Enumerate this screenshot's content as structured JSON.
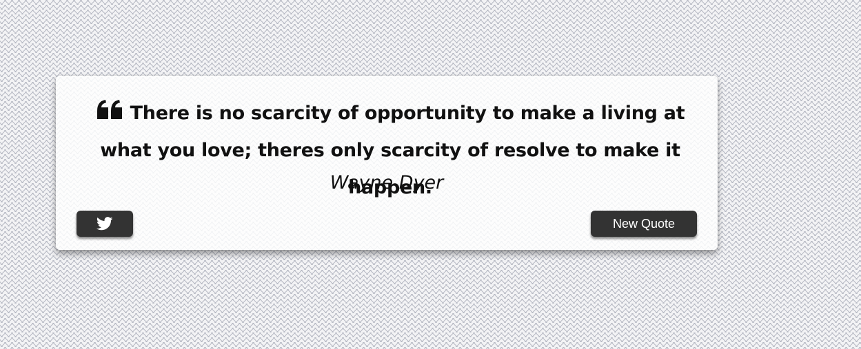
{
  "quote": {
    "text": "There is no scarcity of opportunity to make a living at what you love; theres only scarcity of resolve to make it happen.",
    "author": "Wayne Dyer",
    "icon": "quote-left-icon"
  },
  "buttons": {
    "tweet_icon": "twitter-icon",
    "new_quote_label": "New Quote"
  },
  "colors": {
    "button_background": "#333333",
    "button_text": "#ffffff",
    "text": "#111111"
  }
}
